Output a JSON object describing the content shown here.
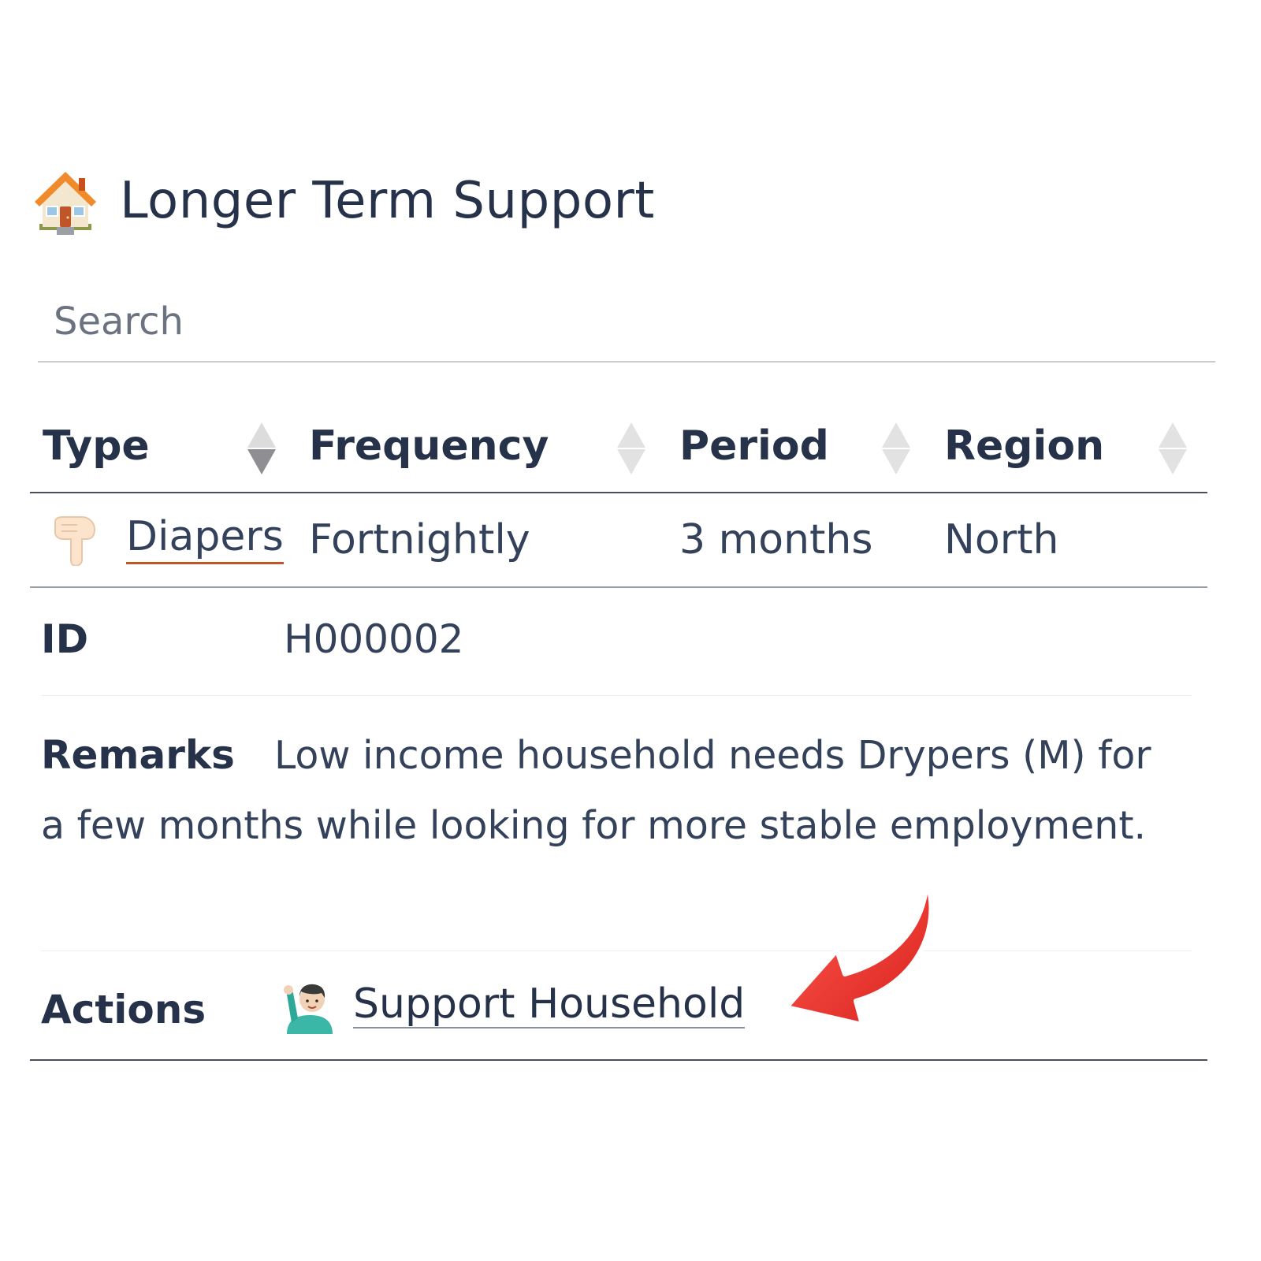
{
  "header": {
    "icon": "house-icon",
    "title": "Longer Term Support"
  },
  "search": {
    "placeholder": "Search",
    "value": ""
  },
  "table": {
    "columns": [
      {
        "label": "Type",
        "sort_state": "descending"
      },
      {
        "label": "Frequency",
        "sort_state": "none"
      },
      {
        "label": "Period",
        "sort_state": "none"
      },
      {
        "label": "Region",
        "sort_state": "none"
      }
    ],
    "rows": [
      {
        "icon": "pointing-down-hand-icon",
        "type": "Diapers",
        "frequency": "Fortnightly",
        "period": "3 months",
        "region": "North"
      }
    ]
  },
  "details": {
    "id_label": "ID",
    "id_value": "H000002",
    "remarks_label": "Remarks",
    "remarks_value": "Low income household needs Drypers (M) for a few months while looking for more stable employment.",
    "actions_label": "Actions",
    "action_icon": "person-raising-hand-icon",
    "action_label": "Support Household"
  },
  "annotation": {
    "icon": "red-curved-arrow-icon",
    "color": "#e32b25"
  },
  "colors": {
    "text_primary": "#26324a",
    "text_secondary": "#33415a",
    "link_underline": "#c0552a",
    "sort_active": "#8e8e93",
    "sort_inactive": "#e0e0e0"
  }
}
